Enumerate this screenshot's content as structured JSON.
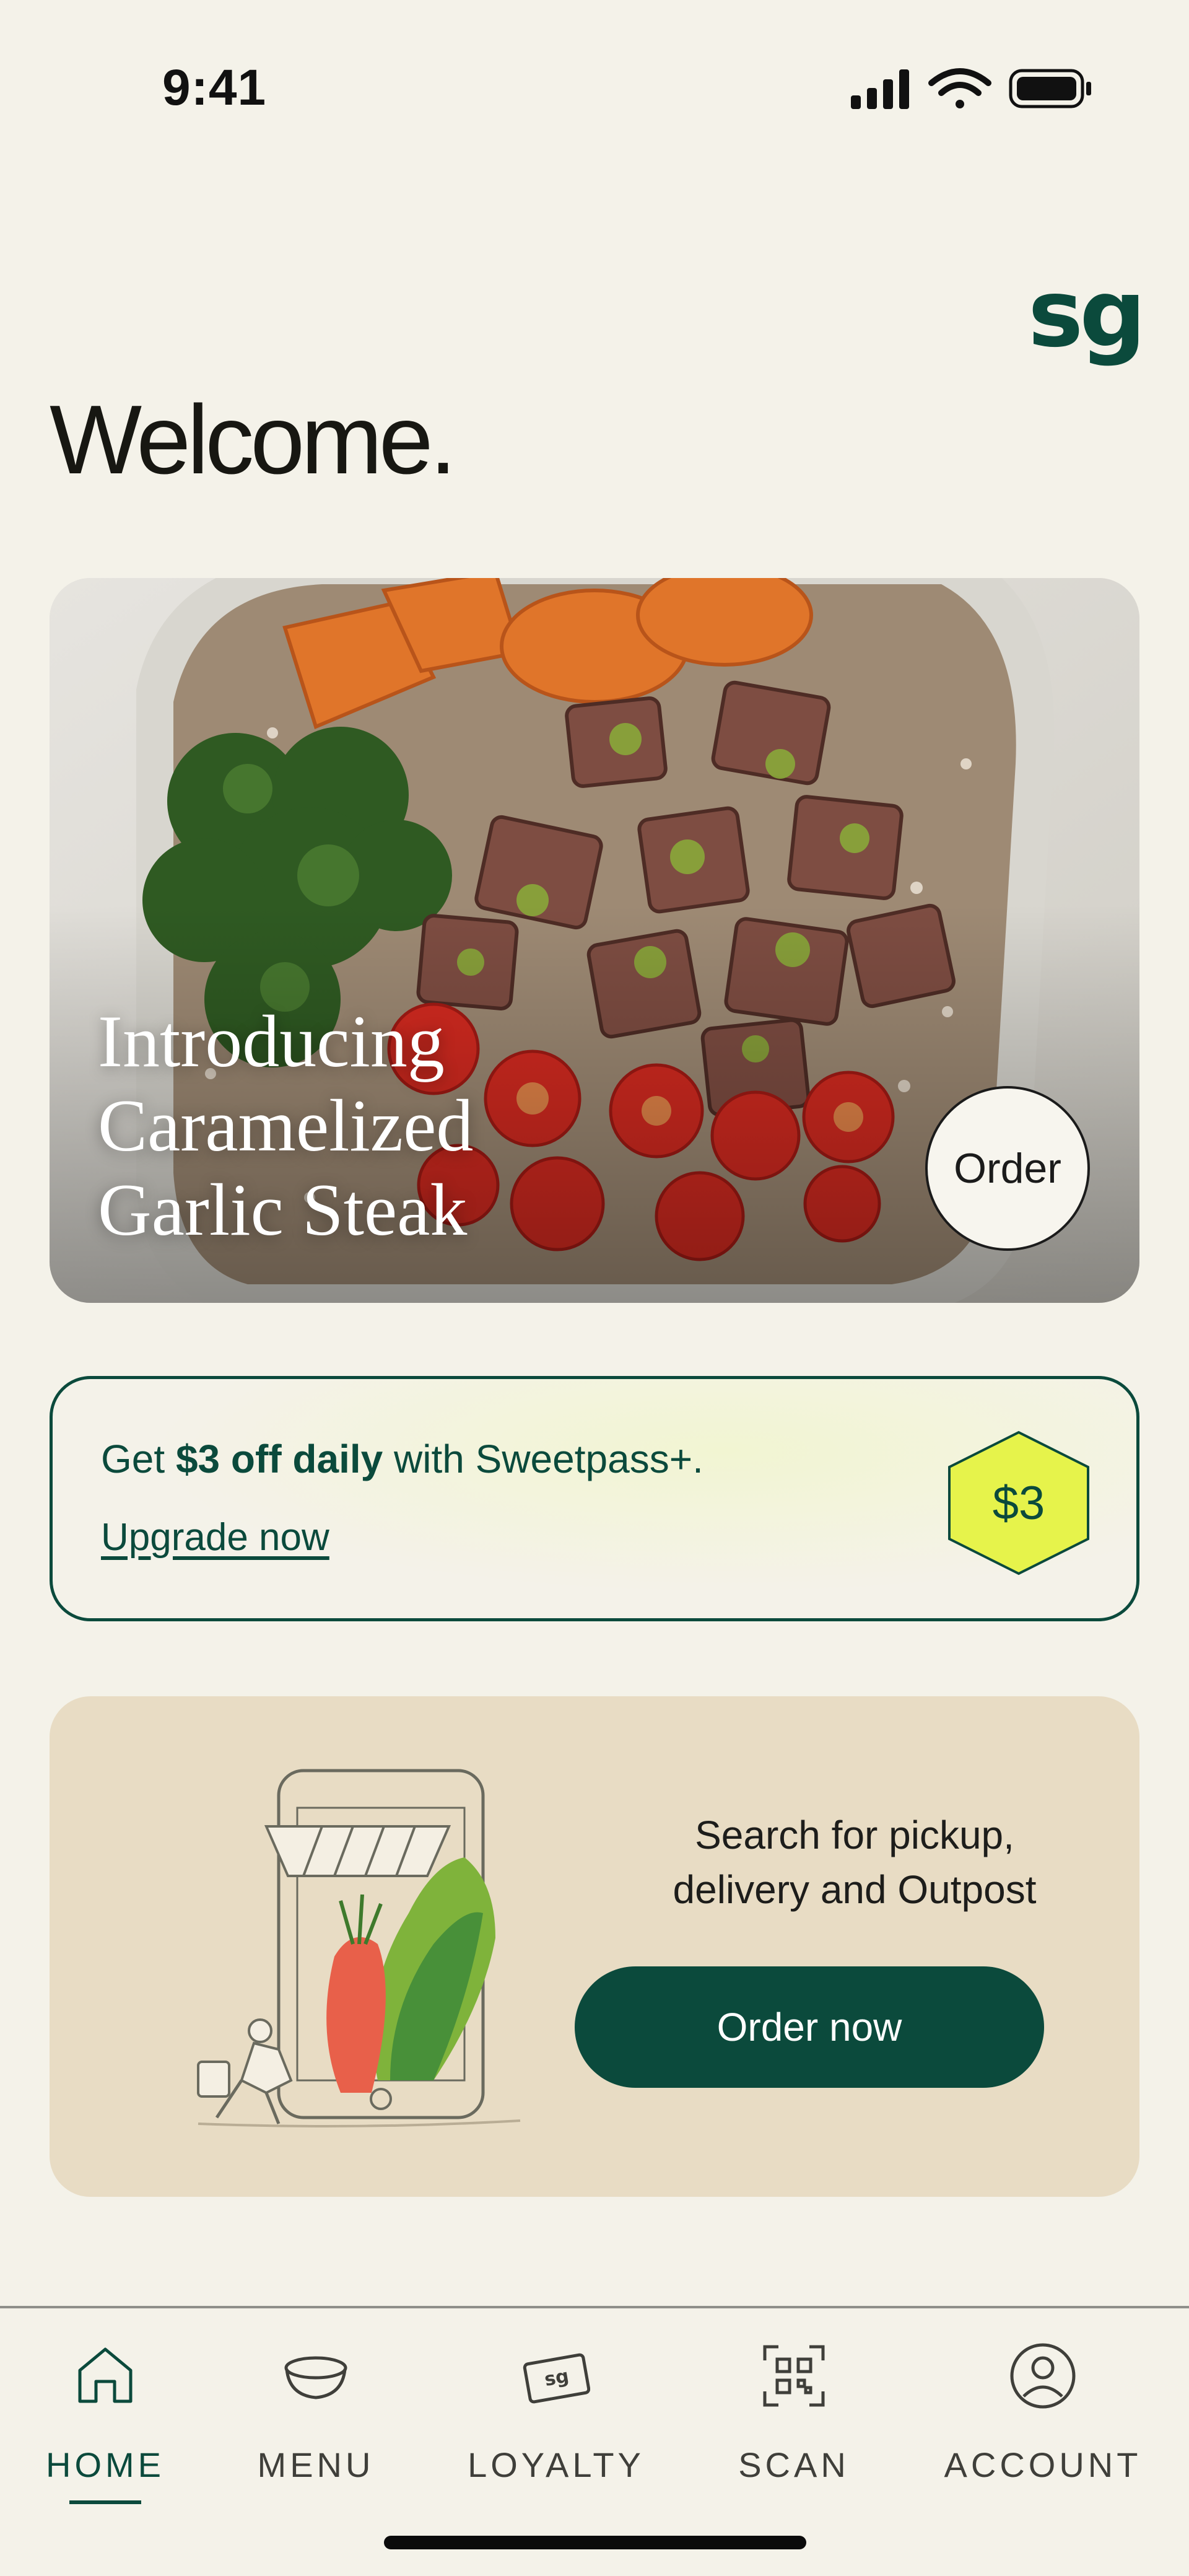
{
  "status_bar": {
    "time": "9:41"
  },
  "header": {
    "logo": "sg",
    "welcome": "Welcome."
  },
  "hero": {
    "title_lines": [
      "Introducing",
      "Caramelized",
      "Garlic Steak"
    ],
    "order_label": "Order"
  },
  "promo": {
    "prefix": "Get ",
    "bold": "$3 off daily",
    "suffix": " with Sweetpass+.",
    "link": "Upgrade now",
    "badge": "$3",
    "badge_color": "#e6f34b",
    "brand_color": "#0b4a3c"
  },
  "pickup": {
    "line1": "Search for pickup,",
    "line2": "delivery and Outpost",
    "button": "Order now",
    "card_color": "#e8dcc4"
  },
  "nav": {
    "items": [
      {
        "label": "HOME",
        "icon": "home-icon",
        "active": true
      },
      {
        "label": "MENU",
        "icon": "bowl-icon",
        "active": false
      },
      {
        "label": "LOYALTY",
        "icon": "sg-card-icon",
        "active": false
      },
      {
        "label": "SCAN",
        "icon": "qr-scan-icon",
        "active": false
      },
      {
        "label": "ACCOUNT",
        "icon": "account-icon",
        "active": false
      }
    ]
  }
}
